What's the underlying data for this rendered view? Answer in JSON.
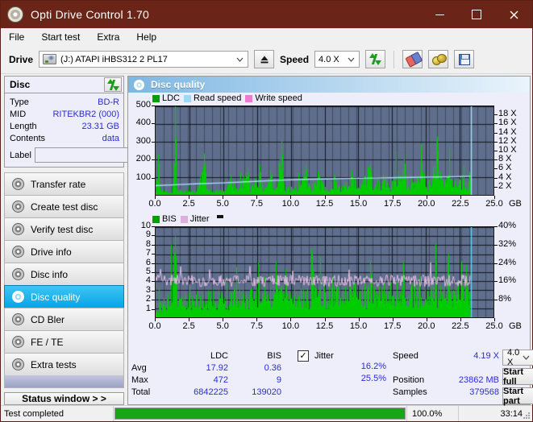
{
  "window": {
    "title": "Opti Drive Control 1.70",
    "icon": "disc-icon",
    "minimize": "−",
    "maximize": "□",
    "close": "✕"
  },
  "menu": {
    "items": [
      {
        "label": "File"
      },
      {
        "label": "Start test"
      },
      {
        "label": "Extra"
      },
      {
        "label": "Help"
      }
    ]
  },
  "drivebar": {
    "drive_label": "Drive",
    "drive_value": "(J:)   ATAPI iHBS312  2 PL17",
    "eject_icon": "eject-icon",
    "speed_label": "Speed",
    "speed_value": "4.0 X",
    "refresh_icon": "refresh-icon",
    "erase_icon": "eraser-icon",
    "tools_icon": "tools-icon",
    "save_icon": "save-icon"
  },
  "disc": {
    "panel_title": "Disc",
    "refresh_icon": "refresh-icon",
    "rows": [
      {
        "key": "Type",
        "value": "BD-R"
      },
      {
        "key": "MID",
        "value": "RITEKBR2 (000)"
      },
      {
        "key": "Length",
        "value": "23.31 GB"
      },
      {
        "key": "Contents",
        "value": "data"
      }
    ],
    "label_key": "Label",
    "label_value": "",
    "label_placeholder": "",
    "disc_button_icon": "disc-icon"
  },
  "nav": {
    "items": [
      {
        "label": "Transfer rate",
        "icon": "disc-icon",
        "active": false
      },
      {
        "label": "Create test disc",
        "icon": "disc-icon",
        "active": false
      },
      {
        "label": "Verify test disc",
        "icon": "disc-icon",
        "active": false
      },
      {
        "label": "Drive info",
        "icon": "disc-icon",
        "active": false
      },
      {
        "label": "Disc info",
        "icon": "disc-icon",
        "active": false
      },
      {
        "label": "Disc quality",
        "icon": "disc-icon",
        "active": true
      },
      {
        "label": "CD Bler",
        "icon": "disc-icon",
        "active": false
      },
      {
        "label": "FE / TE",
        "icon": "disc-icon",
        "active": false
      },
      {
        "label": "Extra tests",
        "icon": "disc-icon",
        "active": false
      }
    ],
    "status_window": "Status window > >"
  },
  "quality": {
    "header_title": "Disc quality",
    "header_icon": "disc-icon"
  },
  "stats": {
    "col_ldc": "LDC",
    "col_bis": "BIS",
    "row_avg": "Avg",
    "row_max": "Max",
    "row_total": "Total",
    "ldc_avg": "17.92",
    "ldc_max": "472",
    "ldc_total": "6842225",
    "bis_avg": "0.36",
    "bis_max": "9",
    "bis_total": "139020",
    "jitter_label": "Jitter",
    "jitter_checked": "✓",
    "jitter_avg": "16.2%",
    "jitter_max": "25.5%",
    "speed_label": "Speed",
    "speed_value": "4.19 X",
    "position_label": "Position",
    "position_value": "23862 MB",
    "samples_label": "Samples",
    "samples_value": "379568",
    "speed_select": "4.0 X",
    "start_full": "Start full",
    "start_part": "Start part"
  },
  "statusbar": {
    "message": "Test completed",
    "progress_percent": "100.0%",
    "progress_value": 100,
    "elapsed": "33:14"
  },
  "chart_data": [
    {
      "type": "line",
      "id": "ldc-chart",
      "title": "",
      "xlabel": "GB",
      "ylabel": "",
      "grid": true,
      "legend_position": "top-left",
      "legend": [
        {
          "name": "LDC",
          "color": "#00a000"
        },
        {
          "name": "Read speed",
          "color": "#9fd8f2"
        },
        {
          "name": "Write speed",
          "color": "#f07ad2"
        }
      ],
      "x": [
        0.0,
        2.5,
        5.0,
        7.5,
        10.0,
        12.5,
        15.0,
        17.5,
        20.0,
        22.5,
        25.0
      ],
      "xtick_labels": [
        "0.0",
        "2.5",
        "5.0",
        "7.5",
        "10.0",
        "12.5",
        "15.0",
        "17.5",
        "20.0",
        "22.5",
        "25.0"
      ],
      "xlim": [
        0,
        25
      ],
      "ylim": [
        0,
        500
      ],
      "ytick_labels": [
        "100",
        "200",
        "300",
        "400",
        "500"
      ],
      "ytick_values": [
        100,
        200,
        300,
        400,
        500
      ],
      "y2lim": [
        0,
        20
      ],
      "y2tick_labels": [
        "2 X",
        "4 X",
        "6 X",
        "8 X",
        "10 X",
        "12 X",
        "14 X",
        "16 X",
        "18 X"
      ],
      "y2tick_values": [
        2,
        4,
        6,
        8,
        10,
        12,
        14,
        16,
        18
      ],
      "x_end_data": 23.3,
      "series": [
        {
          "name": "LDC",
          "color": "#00cc00",
          "type": "area",
          "baseline_profile": [
            [
              0.0,
              55
            ],
            [
              0.15,
              175
            ],
            [
              0.3,
              62
            ],
            [
              0.5,
              40
            ],
            [
              0.8,
              33
            ],
            [
              1.2,
              30
            ],
            [
              1.45,
              425
            ],
            [
              1.55,
              60
            ],
            [
              1.8,
              38
            ],
            [
              2.3,
              30
            ],
            [
              2.6,
              28
            ],
            [
              3.0,
              30
            ],
            [
              3.6,
              235
            ],
            [
              3.8,
              44
            ],
            [
              4.2,
              30
            ],
            [
              5.0,
              32
            ],
            [
              5.6,
              110
            ],
            [
              6.0,
              34
            ],
            [
              6.8,
              155
            ],
            [
              7.0,
              36
            ],
            [
              7.7,
              170
            ],
            [
              8.0,
              38
            ],
            [
              8.5,
              140
            ],
            [
              8.9,
              42
            ],
            [
              9.3,
              305
            ],
            [
              9.6,
              48
            ],
            [
              10.4,
              60
            ],
            [
              11.1,
              170
            ],
            [
              11.4,
              55
            ],
            [
              12.0,
              120
            ],
            [
              12.6,
              50
            ],
            [
              13.2,
              110
            ],
            [
              13.8,
              50
            ],
            [
              14.5,
              140
            ],
            [
              15.1,
              60
            ],
            [
              15.8,
              175
            ],
            [
              16.2,
              58
            ],
            [
              16.8,
              115
            ],
            [
              17.3,
              62
            ],
            [
              17.9,
              135
            ],
            [
              18.3,
              230
            ],
            [
              18.7,
              70
            ],
            [
              19.3,
              95
            ],
            [
              19.7,
              175
            ],
            [
              20.1,
              80
            ],
            [
              20.5,
              160
            ],
            [
              20.8,
              330
            ],
            [
              21.2,
              85
            ],
            [
              21.7,
              120
            ],
            [
              22.2,
              78
            ],
            [
              22.7,
              115
            ],
            [
              23.1,
              95
            ],
            [
              23.3,
              130
            ]
          ],
          "spikes": [
            [
              0.15,
              230
            ],
            [
              1.45,
              425
            ],
            [
              3.6,
              235
            ],
            [
              5.55,
              110
            ],
            [
              6.8,
              155
            ],
            [
              7.7,
              172
            ],
            [
              8.5,
              142
            ],
            [
              9.3,
              305
            ],
            [
              11.1,
              172
            ],
            [
              12.05,
              120
            ],
            [
              13.2,
              112
            ],
            [
              14.5,
              140
            ],
            [
              15.85,
              178
            ],
            [
              16.8,
              116
            ],
            [
              17.9,
              135
            ],
            [
              18.35,
              232
            ],
            [
              19.7,
              176
            ],
            [
              20.5,
              160
            ],
            [
              20.85,
              330
            ],
            [
              21.7,
              122
            ],
            [
              22.7,
              118
            ],
            [
              23.2,
              130
            ]
          ]
        },
        {
          "name": "Read speed",
          "color": "#a8dcf5",
          "type": "line",
          "points": [
            [
              0.0,
              2.1
            ],
            [
              1.5,
              2.3
            ],
            [
              3.0,
              2.5
            ],
            [
              5.0,
              2.7
            ],
            [
              7.0,
              3.0
            ],
            [
              9.0,
              3.3
            ],
            [
              11.0,
              3.5
            ],
            [
              12.5,
              3.6
            ],
            [
              14.0,
              3.7
            ],
            [
              16.0,
              3.8
            ],
            [
              18.0,
              3.9
            ],
            [
              20.0,
              4.0
            ],
            [
              22.0,
              4.1
            ],
            [
              23.3,
              4.2
            ]
          ],
          "end_marker": {
            "x": 23.35,
            "from": 0,
            "to": 20
          }
        },
        {
          "name": "Write speed",
          "color": "#f07ad2",
          "type": "line",
          "points": []
        }
      ]
    },
    {
      "type": "line",
      "id": "bis-jitter-chart",
      "title": "",
      "xlabel": "GB",
      "ylabel": "",
      "grid": true,
      "legend_position": "top-left",
      "legend": [
        {
          "name": "BIS",
          "color": "#00a000"
        },
        {
          "name": "Jitter",
          "color": "#dbafdb"
        }
      ],
      "x": [
        0.0,
        2.5,
        5.0,
        7.5,
        10.0,
        12.5,
        15.0,
        17.5,
        20.0,
        22.5,
        25.0
      ],
      "xtick_labels": [
        "0.0",
        "2.5",
        "5.0",
        "7.5",
        "10.0",
        "12.5",
        "15.0",
        "17.5",
        "20.0",
        "22.5",
        "25.0"
      ],
      "xlim": [
        0,
        25
      ],
      "ylim": [
        0,
        10
      ],
      "ytick_labels": [
        "1",
        "2",
        "3",
        "4",
        "5",
        "6",
        "7",
        "8",
        "9",
        "10"
      ],
      "ytick_values": [
        1,
        2,
        3,
        4,
        5,
        6,
        7,
        8,
        9,
        10
      ],
      "y2lim": [
        0,
        40
      ],
      "y2tick_labels": [
        "8%",
        "16%",
        "24%",
        "32%",
        "40%"
      ],
      "y2tick_values": [
        8,
        16,
        24,
        32,
        40
      ],
      "x_end_data": 23.3,
      "series": [
        {
          "name": "BIS",
          "color": "#00cc00",
          "type": "area",
          "baseline_profile": [
            [
              0.0,
              1.6
            ],
            [
              0.5,
              2.2
            ],
            [
              1.0,
              2.6
            ],
            [
              1.45,
              9.0
            ],
            [
              1.6,
              2.4
            ],
            [
              2.0,
              2.6
            ],
            [
              3.0,
              2.8
            ],
            [
              4.0,
              3.0
            ],
            [
              5.0,
              3.0
            ],
            [
              6.0,
              3.1
            ],
            [
              7.0,
              3.2
            ],
            [
              8.0,
              3.3
            ],
            [
              9.0,
              3.4
            ],
            [
              10.0,
              3.4
            ],
            [
              11.0,
              3.5
            ],
            [
              12.0,
              3.5
            ],
            [
              13.0,
              3.6
            ],
            [
              14.0,
              3.6
            ],
            [
              15.0,
              3.7
            ],
            [
              16.0,
              3.7
            ],
            [
              17.0,
              3.8
            ],
            [
              18.0,
              3.8
            ],
            [
              19.0,
              3.9
            ],
            [
              20.0,
              3.9
            ],
            [
              21.0,
              4.0
            ],
            [
              22.0,
              4.1
            ],
            [
              23.0,
              4.2
            ],
            [
              23.3,
              4.3
            ]
          ],
          "spikes": [
            [
              1.45,
              9.0
            ],
            [
              7.6,
              6.1
            ],
            [
              8.9,
              6.2
            ],
            [
              9.6,
              5.4
            ],
            [
              11.6,
              7.1
            ],
            [
              15.9,
              6.3
            ],
            [
              18.3,
              6.1
            ],
            [
              20.7,
              8.2
            ],
            [
              21.6,
              6.0
            ],
            [
              22.6,
              6.2
            ],
            [
              23.0,
              5.8
            ]
          ]
        },
        {
          "name": "Jitter",
          "color": "#e3bde3",
          "type": "line",
          "mean_percent": 16.2,
          "max_percent": 25.5,
          "noise_amplitude_percent": 2.6
        }
      ]
    }
  ]
}
